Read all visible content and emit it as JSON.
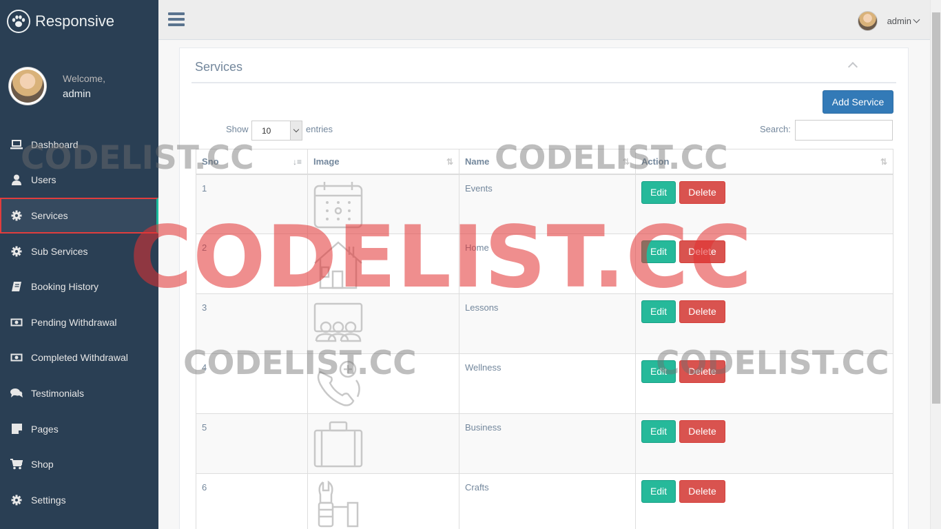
{
  "brand": {
    "title": "Responsive",
    "logo_icon": "paw-icon"
  },
  "profile": {
    "welcome": "Welcome,",
    "name": "admin"
  },
  "sidebar": {
    "items": [
      {
        "label": "Dashboard",
        "icon": "laptop-icon"
      },
      {
        "label": "Users",
        "icon": "user-icon"
      },
      {
        "label": "Services",
        "icon": "gear-icon",
        "active": true
      },
      {
        "label": "Sub Services",
        "icon": "gear-icon"
      },
      {
        "label": "Booking History",
        "icon": "book-icon"
      },
      {
        "label": "Pending Withdrawal",
        "icon": "money-icon"
      },
      {
        "label": "Completed Withdrawal",
        "icon": "money-icon"
      },
      {
        "label": "Testimonials",
        "icon": "comments-icon"
      },
      {
        "label": "Pages",
        "icon": "sticky-note-icon"
      },
      {
        "label": "Shop",
        "icon": "cart-icon"
      },
      {
        "label": "Settings",
        "icon": "gear-icon"
      }
    ]
  },
  "topbar": {
    "user": "admin"
  },
  "panel": {
    "title": "Services",
    "add_button": "Add Service"
  },
  "table_controls": {
    "show": "Show",
    "page_length": "10",
    "entries": "entries",
    "search_label": "Search:"
  },
  "table": {
    "headers": [
      "Sno",
      "Image",
      "Name",
      "Action"
    ],
    "edit_label": "Edit",
    "delete_label": "Delete",
    "rows": [
      {
        "sno": "1",
        "name": "Events",
        "image_icon": "calendar-icon"
      },
      {
        "sno": "2",
        "name": "Home",
        "image_icon": "house-icon"
      },
      {
        "sno": "3",
        "name": "Lessons",
        "image_icon": "classroom-icon"
      },
      {
        "sno": "4",
        "name": "Wellness",
        "image_icon": "phone-plus-icon"
      },
      {
        "sno": "5",
        "name": "Business",
        "image_icon": "briefcase-icon"
      },
      {
        "sno": "6",
        "name": "Crafts",
        "image_icon": "tools-icon"
      }
    ]
  },
  "watermark": {
    "text": "CODELIST.CC"
  },
  "colors": {
    "sidebar_bg": "#2a3f54",
    "edit_green": "#26b99a",
    "delete_red": "#d9534f",
    "primary_blue": "#337ab7",
    "watermark_red": "#e23232"
  }
}
